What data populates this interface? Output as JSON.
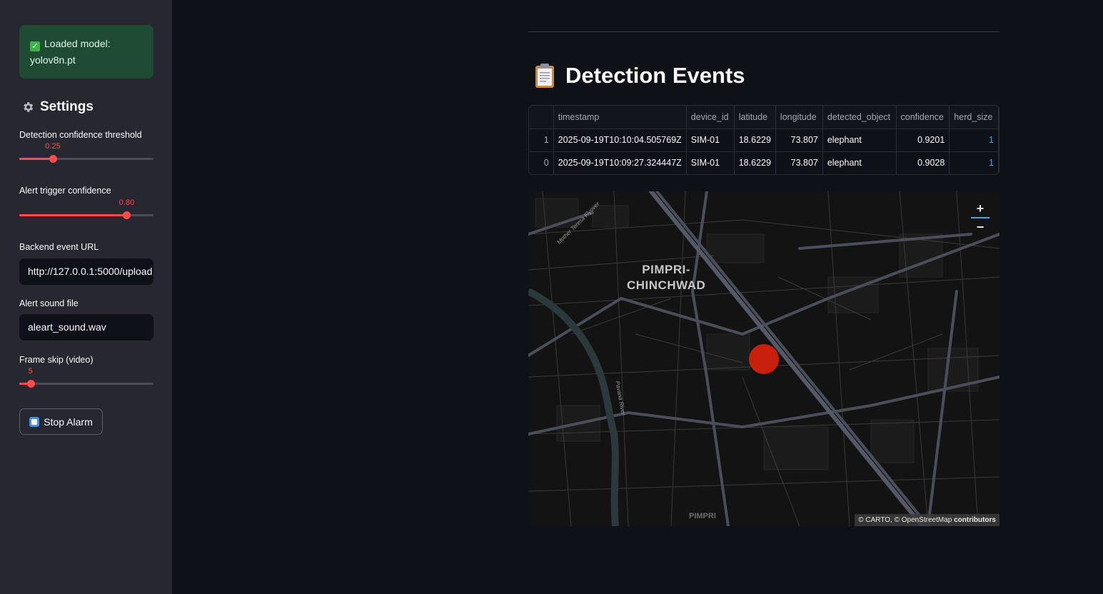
{
  "sidebar": {
    "model_status": {
      "line1": "Loaded model:",
      "line2": "yolov8n.pt"
    },
    "settings_title": "Settings",
    "detection_threshold": {
      "label": "Detection confidence threshold",
      "value_text": "0.25",
      "value": 0.25,
      "min": 0,
      "max": 1
    },
    "alert_confidence": {
      "label": "Alert trigger confidence",
      "value_text": "0.80",
      "value": 0.8,
      "min": 0,
      "max": 1
    },
    "backend_url": {
      "label": "Backend event URL",
      "value": "http://127.0.0.1:5000/upload"
    },
    "alert_sound": {
      "label": "Alert sound file",
      "value": "aleart_sound.wav"
    },
    "frame_skip": {
      "label": "Frame skip (video)",
      "value_text": "5",
      "value": 5,
      "min": 0,
      "max": 60
    },
    "stop_button": "Stop Alarm"
  },
  "main": {
    "title": "Detection Events",
    "table": {
      "columns": [
        "",
        "timestamp",
        "device_id",
        "latitude",
        "longitude",
        "detected_object",
        "confidence",
        "herd_size"
      ],
      "rows": [
        [
          "1",
          "2025-09-19T10:10:04.505769Z",
          "SIM-01",
          "18.6229",
          "73.807",
          "elephant",
          "0.9201",
          "1"
        ],
        [
          "0",
          "2025-09-19T10:09:27.324447Z",
          "SIM-01",
          "18.6229",
          "73.807",
          "elephant",
          "0.9028",
          "1"
        ]
      ]
    },
    "map": {
      "city_label_1": "PIMPRI-",
      "city_label_2": "CHINCHWAD",
      "bottom_label": "PIMPRI",
      "flyover_label": "Mother Teresa Flyover",
      "river_label": "Pavana River",
      "zoom_in": "+",
      "zoom_out": "−",
      "attribution_1": "© CARTO, © OpenStreetMap",
      "attribution_2": "contributors",
      "marker_color": "#c8200c"
    }
  },
  "colors": {
    "accent": "#ff4b4b",
    "success_bg": "#1f4a33",
    "sidebar_bg": "#262730",
    "main_bg": "#0e1117"
  }
}
